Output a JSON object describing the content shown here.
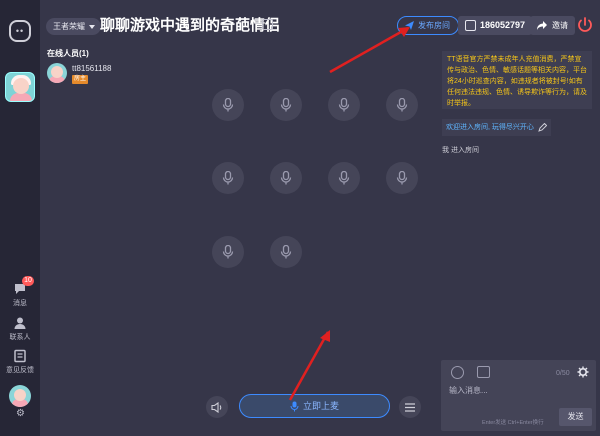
{
  "sidebar": {
    "messages_label": "消息",
    "messages_badge": "10",
    "contacts_label": "联系人",
    "feedback_label": "意见反馈"
  },
  "header": {
    "game_tag": "王者荣耀",
    "room_title": "聊聊游戏中遇到的奇葩情侣",
    "share_label": "发布房间",
    "room_id": "186052797",
    "invite_label": "邀请"
  },
  "online": {
    "title": "在线人员(1)",
    "members": [
      {
        "name": "tt81561188",
        "role": "房主"
      }
    ]
  },
  "controls": {
    "join_mic_label": "立即上麦"
  },
  "chat": {
    "notice": "TT语音官方严禁未成年人充值消费，严禁宣传与政治、色情、敏感话题等相关内容，平台将24小时巡查内容，如违规者将被封号!如有任何违法违规、色情、诱导欺诈等行为，请及时举报。",
    "welcome": "欢迎进入房间, 玩得尽兴开心",
    "enter_message": "我 进入房间",
    "char_count": "0/50",
    "input_placeholder": "输入消息...",
    "hint": "Enter发送 Ctrl+Enter换行",
    "send_label": "发送"
  },
  "colors": {
    "accent": "#3d8bff",
    "notice": "#f5c518",
    "role_badge": "#e58a2b",
    "power": "#ff5a5a"
  }
}
